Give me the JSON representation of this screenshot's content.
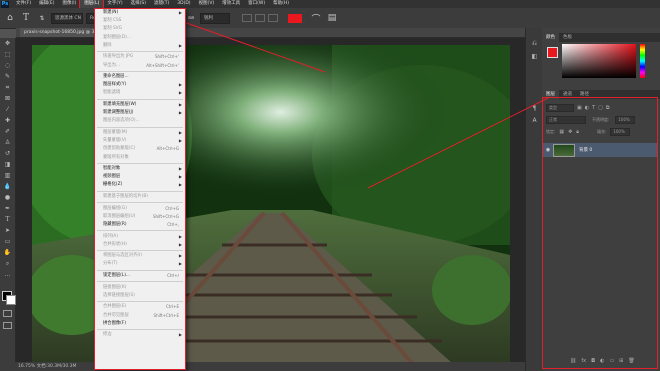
{
  "menubar": {
    "items": [
      "文件(F)",
      "编辑(E)",
      "图像(I)",
      "图层(L)",
      "文字(Y)",
      "选择(S)",
      "滤镜(T)",
      "3D(D)",
      "视图(V)",
      "增效工具",
      "窗口(W)",
      "帮助(H)"
    ],
    "active_index": 3
  },
  "options": {
    "font_family": "思源黑体 CN",
    "font_style": "Regular",
    "font_size": "36 点",
    "anti_alias": "锐利"
  },
  "document_tab": "praxis-snapshot-16850.jpg @ 33.3% (RGB/8)",
  "status_bar": "16.75%   文档:30.3M/30.3M",
  "layer_menu": {
    "items": [
      {
        "label": "新建(N)",
        "arrow": true,
        "enabled": true
      },
      {
        "label": "复制 CSS",
        "enabled": false
      },
      {
        "label": "复制 SVG",
        "enabled": false
      },
      {
        "label": "复制图层(D)...",
        "enabled": false
      },
      {
        "label": "删除",
        "arrow": true,
        "enabled": false
      },
      {
        "sep": true
      },
      {
        "label": "快速导出为 JPG",
        "shortcut": "Shift+Ctrl+'",
        "enabled": false
      },
      {
        "label": "导出为...",
        "shortcut": "Alt+Shift+Ctrl+'",
        "enabled": false
      },
      {
        "sep": true
      },
      {
        "label": "重命名图层...",
        "enabled": true
      },
      {
        "label": "图层样式(Y)",
        "arrow": true,
        "enabled": true
      },
      {
        "label": "智能滤镜",
        "arrow": true,
        "enabled": false
      },
      {
        "sep": true
      },
      {
        "label": "新建填充图层(W)",
        "arrow": true,
        "enabled": true
      },
      {
        "label": "新建调整图层(J)",
        "arrow": true,
        "enabled": true
      },
      {
        "label": "图层内容选项(O)...",
        "enabled": false
      },
      {
        "sep": true
      },
      {
        "label": "图层蒙版(M)",
        "arrow": true,
        "enabled": false
      },
      {
        "label": "矢量蒙版(V)",
        "arrow": true,
        "enabled": false
      },
      {
        "label": "创建剪贴蒙版(C)",
        "shortcut": "Alt+Ctrl+G",
        "enabled": false
      },
      {
        "label": "蒙版所有对象",
        "enabled": false
      },
      {
        "sep": true
      },
      {
        "label": "智能对象",
        "arrow": true,
        "enabled": true
      },
      {
        "label": "视频图层",
        "arrow": true,
        "enabled": true
      },
      {
        "label": "栅格化(Z)",
        "arrow": true,
        "enabled": true
      },
      {
        "sep": true
      },
      {
        "label": "新建基于图层的切片(B)",
        "enabled": false
      },
      {
        "sep": true
      },
      {
        "label": "图层编组(G)",
        "shortcut": "Ctrl+G",
        "enabled": false
      },
      {
        "label": "取消图层编组(U)",
        "shortcut": "Shift+Ctrl+G",
        "enabled": false
      },
      {
        "label": "隐藏图层(R)",
        "shortcut": "Ctrl+,",
        "enabled": true
      },
      {
        "sep": true
      },
      {
        "label": "排列(A)",
        "arrow": true,
        "enabled": false
      },
      {
        "label": "合并形状(H)",
        "arrow": true,
        "enabled": false
      },
      {
        "sep": true
      },
      {
        "label": "将图层与选区对齐(I)",
        "arrow": true,
        "enabled": false
      },
      {
        "label": "分布(T)",
        "arrow": true,
        "enabled": false
      },
      {
        "sep": true
      },
      {
        "label": "锁定图层(L)...",
        "shortcut": "Ctrl+/",
        "enabled": true
      },
      {
        "sep": true
      },
      {
        "label": "链接图层(K)",
        "enabled": false
      },
      {
        "label": "选择链接图层(S)",
        "enabled": false
      },
      {
        "sep": true
      },
      {
        "label": "合并图层(E)",
        "shortcut": "Ctrl+E",
        "enabled": false
      },
      {
        "label": "合并可见图层",
        "shortcut": "Shift+Ctrl+E",
        "enabled": false
      },
      {
        "label": "拼合图像(F)",
        "enabled": true
      },
      {
        "sep": true
      },
      {
        "label": "修边",
        "arrow": true,
        "enabled": false
      }
    ]
  },
  "panels": {
    "color_tabs": [
      "颜色",
      "色板"
    ],
    "layer_tabs": [
      "图层",
      "通道",
      "路径"
    ],
    "layer_filter": "类型",
    "blend_mode": "正常",
    "opacity_label": "不透明度:",
    "opacity_value": "100%",
    "lock_label": "锁定:",
    "fill_label": "填充:",
    "fill_value": "100%",
    "layer_name": "背景 0"
  },
  "colors": {
    "foreground": "#e8181e",
    "accent": "#e0202a"
  }
}
